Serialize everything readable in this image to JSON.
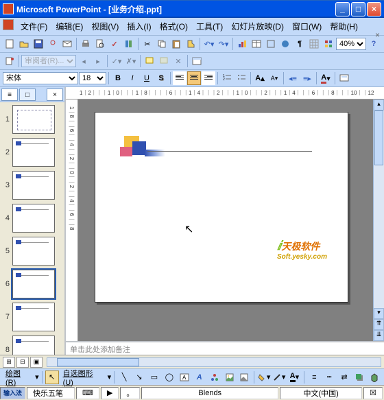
{
  "title": "Microsoft PowerPoint - [业务介绍.ppt]",
  "menus": {
    "file": "文件(F)",
    "edit": "编辑(E)",
    "view": "视图(V)",
    "insert": "插入(I)",
    "format": "格式(O)",
    "tools": "工具(T)",
    "slideshow": "幻灯片放映(D)",
    "window": "窗口(W)",
    "help": "帮助(H)"
  },
  "toolbar": {
    "zoom": "40%",
    "reviewer_label": "审阅者(R)..."
  },
  "format": {
    "font": "宋体",
    "size": "18",
    "bold": "B",
    "italic": "I",
    "underline": "U",
    "shadow": "S",
    "font_grow": "A",
    "font_shrink": "A"
  },
  "ruler": "1｜2｜｜｜1｜0｜｜｜1｜8｜｜｜｜6｜｜｜1｜4｜｜｜2｜｜｜1｜0｜｜｜2｜｜｜1｜4｜｜｜6｜｜｜8｜｜｜10｜｜12",
  "vruler": "1｜8｜｜6｜｜4｜｜2｜｜0｜｜2｜｜4｜｜6｜｜8",
  "slide_count": 8,
  "selected_slide": 6,
  "notes_placeholder": "单击此处添加备注",
  "drawbar": {
    "draw": "绘图(R)",
    "autoshapes": "自选图形(U)",
    "textbox_a": "A"
  },
  "status": {
    "ime_label": "快乐五笔",
    "design": "Blends",
    "lang": "中文(中国)"
  },
  "watermark": {
    "main": "天极软件",
    "sub": "Soft.yesky.com"
  }
}
